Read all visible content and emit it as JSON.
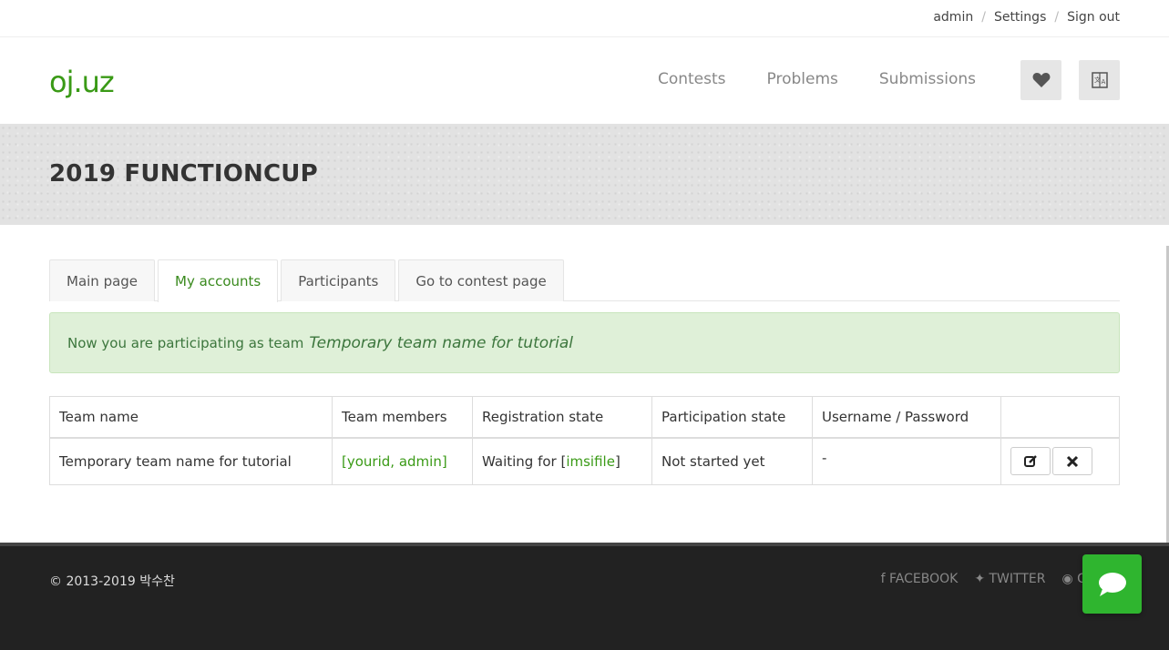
{
  "topbar": {
    "user": "admin",
    "settings": "Settings",
    "signout": "Sign out",
    "separator": "/"
  },
  "header": {
    "logo": "oj.uz",
    "nav": [
      "Contests",
      "Problems",
      "Submissions"
    ],
    "buttons": [
      "heart-icon",
      "translate-icon"
    ]
  },
  "banner": {
    "title": "2019 FUNCTIONCUP"
  },
  "tabs": [
    "Main page",
    "My accounts",
    "Participants",
    "Go to contest page"
  ],
  "active_tab": "My accounts",
  "alert": {
    "text": "Now you are participating as team",
    "team": "Temporary team name for tutorial"
  },
  "table": {
    "headers": [
      "Team name",
      "Team members",
      "Registration state",
      "Participation state",
      "Username / Password",
      ""
    ],
    "row": {
      "team_name": "Temporary team name for tutorial",
      "members_open": "[",
      "member1": "yourid",
      "member_sep": ", ",
      "member2": "admin",
      "members_close": "]",
      "reg_prefix": "Waiting for [",
      "reg_user": "imsifile",
      "reg_close": "]",
      "participation": "Not started yet",
      "credentials": "-"
    }
  },
  "footer": {
    "copyright": "© 2013-2019 박수찬",
    "social": [
      "FACEBOOK",
      "TWITTER",
      "G"
    ]
  },
  "colors": {
    "brand": "#3a9a16",
    "chat": "#2fb52f",
    "alert_bg": "#dff0d8"
  }
}
